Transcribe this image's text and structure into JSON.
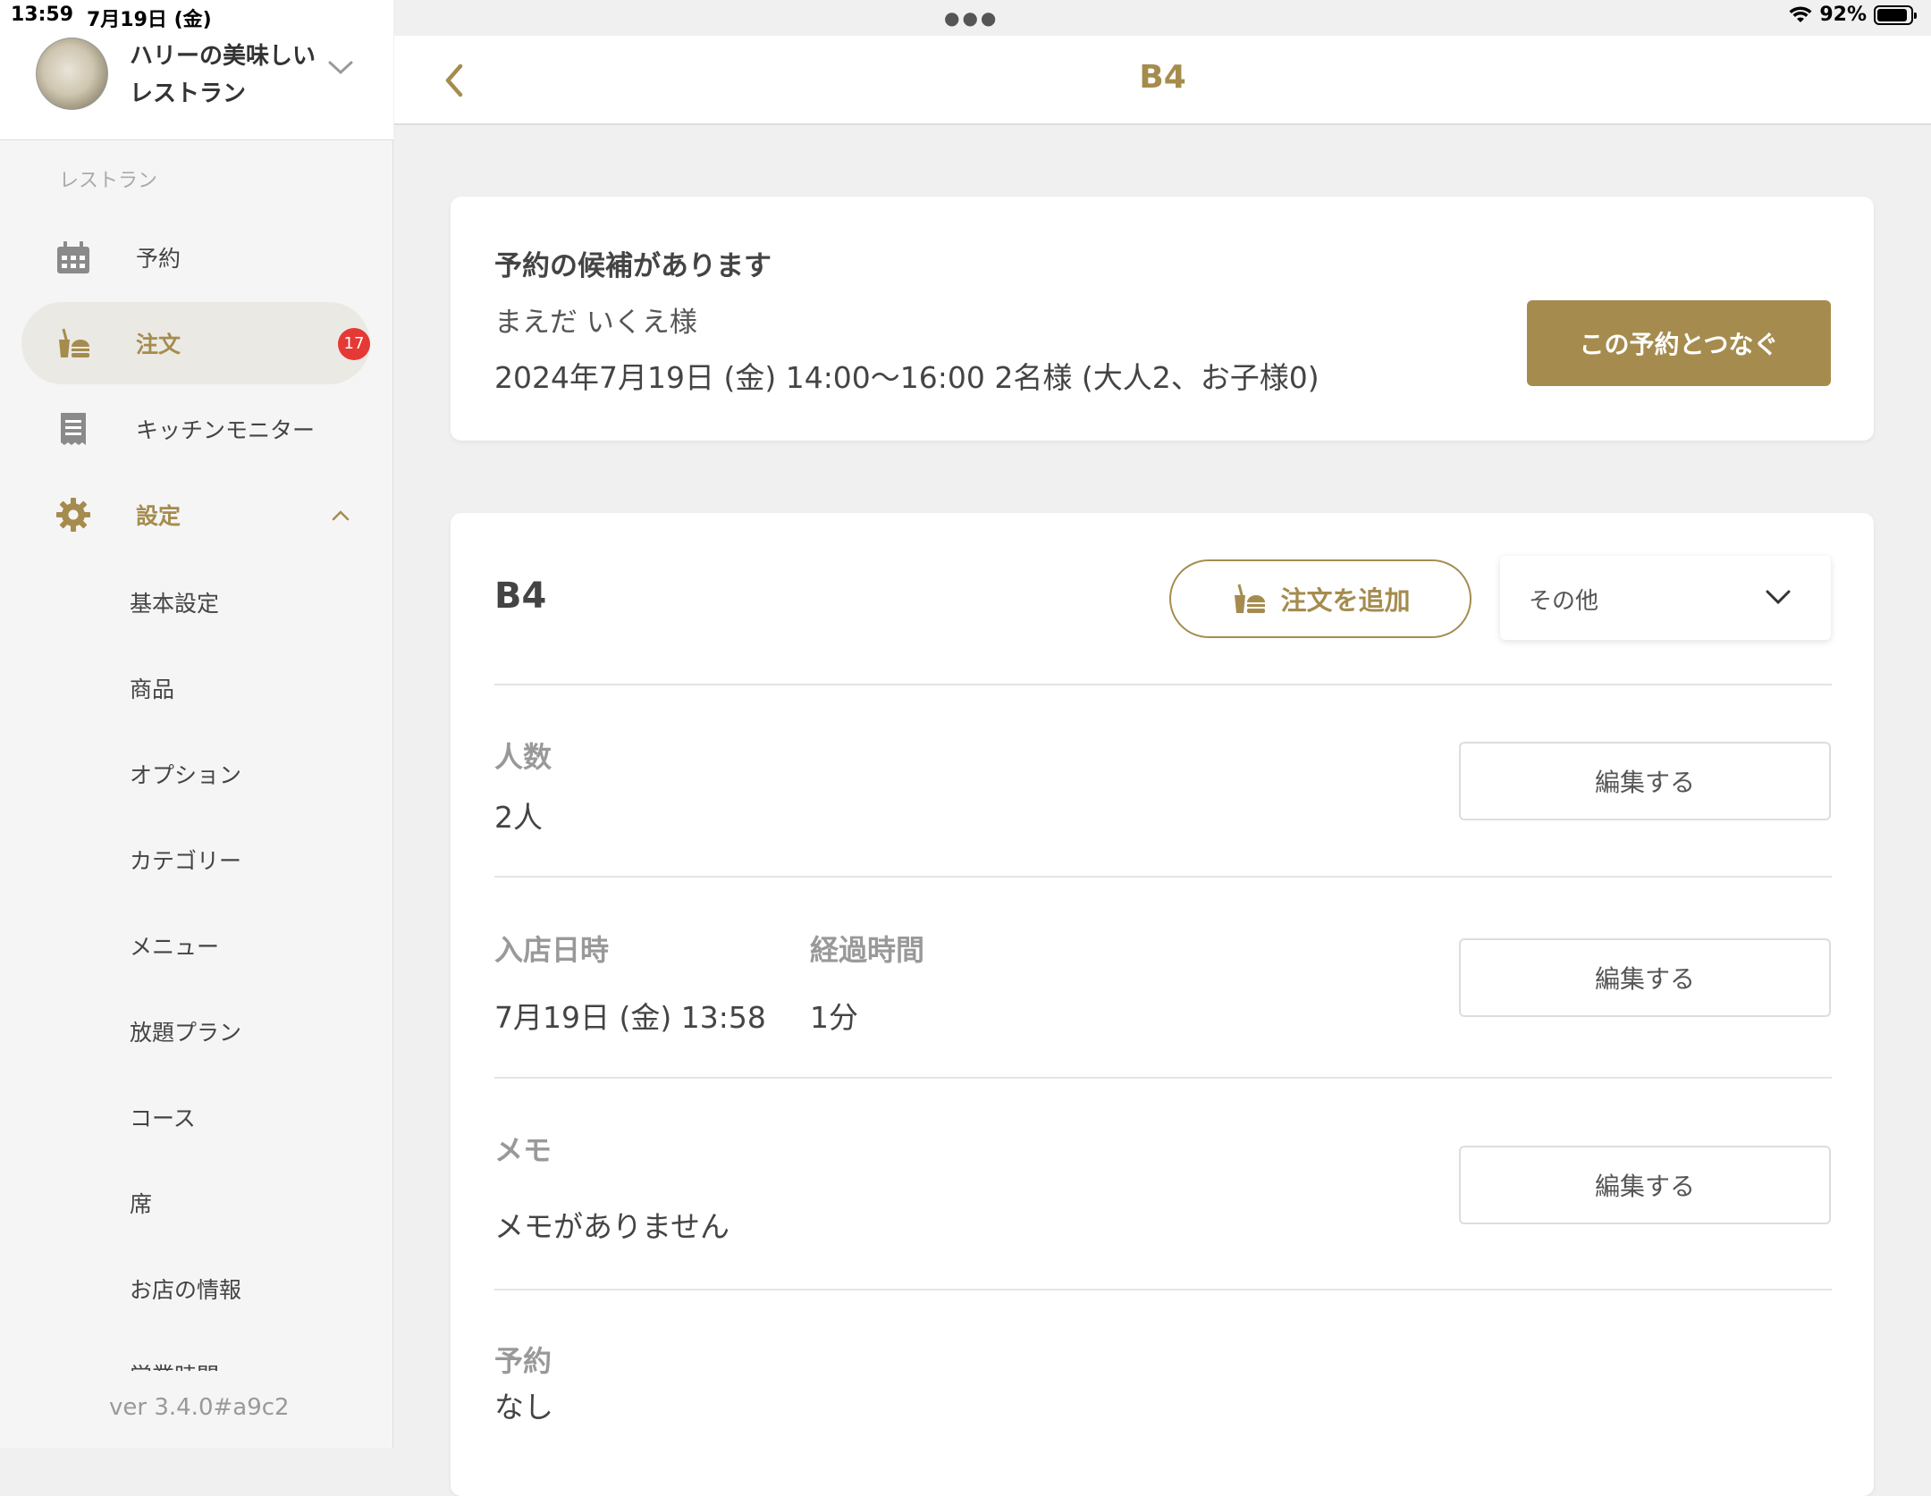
{
  "status_bar": {
    "time": "13:59",
    "date": "7月19日 (金)",
    "battery": "92%",
    "battery_level": 0.92
  },
  "sidebar": {
    "shop_name_line1": "ハリーの美味しい",
    "shop_name_line2": "レストラン",
    "section_label": "レストラン",
    "nav": {
      "reservation": "予約",
      "order": "注文",
      "order_badge": "17",
      "kitchen": "キッチンモニター",
      "settings": "設定"
    },
    "settings_items": [
      "基本設定",
      "商品",
      "オプション",
      "カテゴリー",
      "メニュー",
      "放題プラン",
      "コース",
      "席",
      "お店の情報",
      "営業時間"
    ],
    "version": "ver 3.4.0#a9c2"
  },
  "header": {
    "title": "B4"
  },
  "suggestion": {
    "title": "予約の候補があります",
    "customer": "まえだ いくえ様",
    "details": "2024年7月19日 (金) 14:00～16:00 2名様 (大人2、お子様0)",
    "connect_button": "この予約とつなぐ"
  },
  "table": {
    "name": "B4",
    "add_order_button": "注文を追加",
    "other_select": "その他",
    "people_label": "人数",
    "people_value": "2人",
    "entry_label": "入店日時",
    "entry_value": "7月19日 (金) 13:58",
    "elapsed_label": "経過時間",
    "elapsed_value": "1分",
    "memo_label": "メモ",
    "memo_value": "メモがありません",
    "reservation_label": "予約",
    "reservation_value": "なし",
    "edit_button": "編集する"
  },
  "colors": {
    "accent": "#a58c4e",
    "badge": "#e53935",
    "background": "#f0f0f0"
  }
}
